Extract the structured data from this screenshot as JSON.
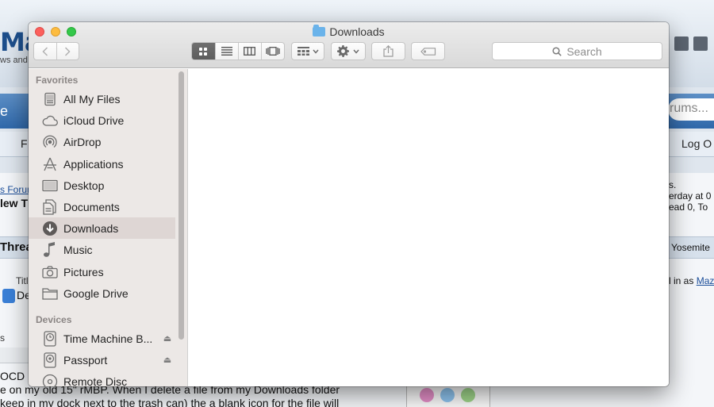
{
  "window": {
    "title": "Downloads",
    "search_placeholder": "Search"
  },
  "toolbar": {
    "back_icon": "chevron-left-icon",
    "forward_icon": "chevron-right-icon",
    "views": [
      {
        "name": "icon-view-icon",
        "active": true
      },
      {
        "name": "list-view-icon",
        "active": false
      },
      {
        "name": "column-view-icon",
        "active": false
      },
      {
        "name": "coverflow-view-icon",
        "active": false
      }
    ],
    "arrange_icon": "arrange-grid-icon",
    "action_icon": "gear-icon",
    "share_icon": "share-icon",
    "tag_icon": "tag-icon"
  },
  "sidebar": {
    "favorites_header": "Favorites",
    "favorites": [
      {
        "label": "All My Files",
        "icon": "all-my-files-icon"
      },
      {
        "label": "iCloud Drive",
        "icon": "cloud-icon"
      },
      {
        "label": "AirDrop",
        "icon": "airdrop-icon"
      },
      {
        "label": "Applications",
        "icon": "applications-icon"
      },
      {
        "label": "Desktop",
        "icon": "desktop-icon"
      },
      {
        "label": "Documents",
        "icon": "documents-icon"
      },
      {
        "label": "Downloads",
        "icon": "downloads-icon",
        "active": true
      },
      {
        "label": "Music",
        "icon": "music-icon"
      },
      {
        "label": "Pictures",
        "icon": "camera-icon"
      },
      {
        "label": "Google Drive",
        "icon": "folder-icon"
      }
    ],
    "devices_header": "Devices",
    "devices": [
      {
        "label": "Time Machine B...",
        "icon": "time-machine-icon",
        "eject": true
      },
      {
        "label": "Passport",
        "icon": "disk-icon",
        "eject": true
      },
      {
        "label": "Remote Disc",
        "icon": "disc-icon",
        "eject": false
      }
    ]
  },
  "background": {
    "logo_text": "Mac",
    "tag_text": "ws and",
    "nav_left_text": "e",
    "search_text": "rums...",
    "sub_left_text": "F",
    "logout_text": "Log O",
    "crumb_text": "s Forum",
    "new_thread_text": "lew T",
    "right_info_line1": "s.",
    "right_info_line2": "erday at 0",
    "right_info_line3": "ead 0, To",
    "thread_header_text": "Threa",
    "yosemite_text": "Yosemite",
    "title_label": "Titl",
    "de_text": "De",
    "logged_in_text": "l in as",
    "logged_in_user": "Maz",
    "s_text": "s",
    "post_line1": "OCD",
    "post_line2": "e on my old 15\" rMBP. When I delete a file from my Downloads folder",
    "post_line3": "keep in my dock next to the trash can) the a blank icon for the file will"
  },
  "colors": {
    "active_view": "#666666",
    "sidebar_bg": "#ece8e6",
    "sidebar_selected": "#ded6d4",
    "traffic_close": "#fc605c",
    "traffic_min": "#fdbc40",
    "traffic_zoom": "#34c84a"
  }
}
